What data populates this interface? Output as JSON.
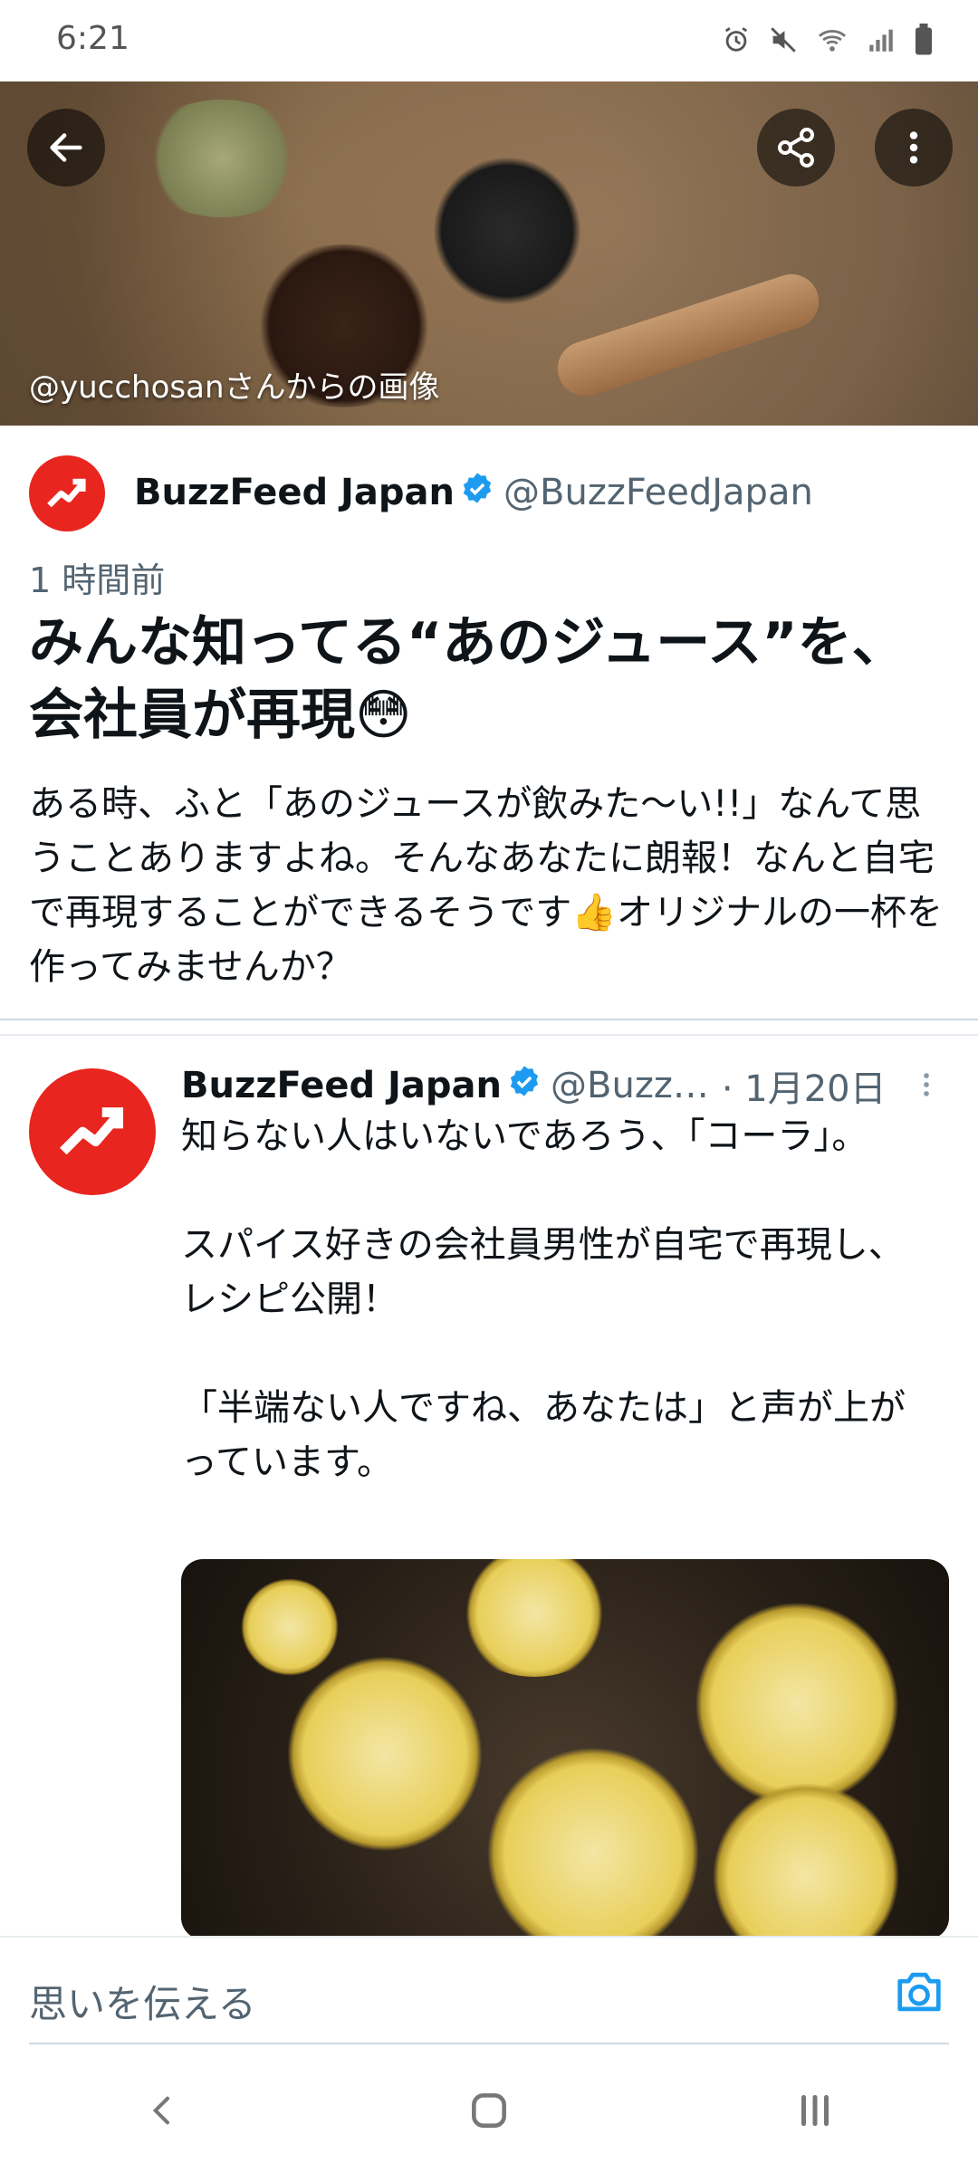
{
  "status_bar": {
    "time": "6:21",
    "icons": [
      "alarm-icon",
      "mute-icon",
      "wifi-icon",
      "signal-icon",
      "battery-icon"
    ]
  },
  "hero": {
    "caption": "@yucchosanさんからの画像",
    "back_icon": "arrow-left-icon",
    "share_icon": "share-icon",
    "more_icon": "more-vertical-icon"
  },
  "tweet": {
    "author_name": "BuzzFeed Japan",
    "author_handle": "@BuzzFeedJapan",
    "time_ago": "1 時間前",
    "headline": "みんな知ってる“あのジュース”を、会社員が再現😳",
    "summary": "ある時、ふと「あのジュースが飲みた〜い!!」なんて思うことありますよね。そんなあなたに朗報！なんと自宅で再現することができるそうです👍オリジナルの一杯を作ってみませんか？"
  },
  "embedded_tweet": {
    "author_name": "BuzzFeed Japan",
    "author_handle": "@Buzz…",
    "date": "· 1月20日",
    "body": "知らない人はいないであろう、「コーラ」。\n\nスパイス好きの会社員男性が自宅で再現し、レシピ公開！\n\n「半端ない人ですね、あなたは」と声が上がっています。"
  },
  "composer": {
    "placeholder": "思いを伝える",
    "camera_icon": "camera-icon"
  },
  "nav": {
    "back": "back-icon",
    "home": "home-icon",
    "recents": "recents-icon"
  },
  "colors": {
    "brand_red": "#e8251e",
    "verified_blue": "#1d9bf0",
    "text_secondary": "#536471"
  }
}
